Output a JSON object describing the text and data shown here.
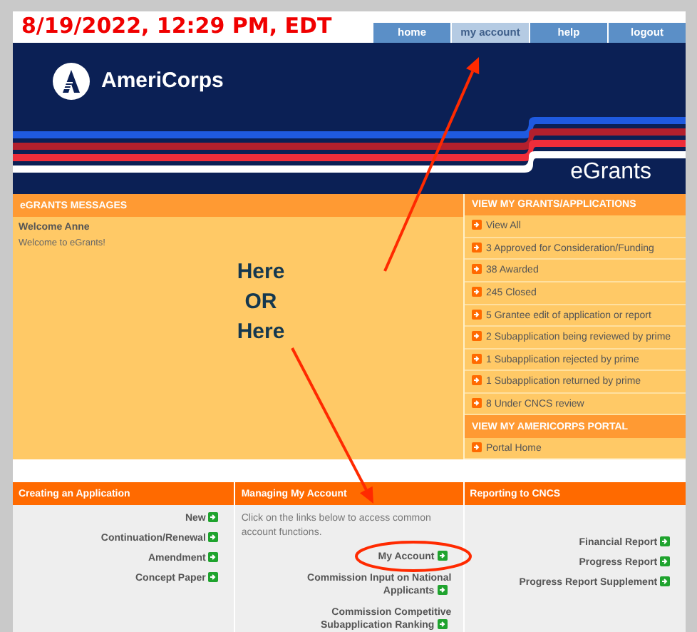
{
  "timestamp": "8/19/2022, 12:29 PM, EDT",
  "nav": [
    {
      "label": "home",
      "selected": false
    },
    {
      "label": "my account",
      "selected": true
    },
    {
      "label": "help",
      "selected": false
    },
    {
      "label": "logout",
      "selected": false
    }
  ],
  "banner": {
    "brand": "AmeriCorps",
    "product": "eGrants"
  },
  "messages": {
    "title": "eGRANTS MESSAGES",
    "greeting": "Welcome Anne",
    "text": "Welcome to eGrants!",
    "callout": [
      "Here",
      "OR",
      "Here"
    ]
  },
  "side_sections": [
    {
      "title": "VIEW MY GRANTS/APPLICATIONS",
      "items": [
        "View All",
        "3 Approved for Consideration/Funding",
        "38 Awarded",
        "245 Closed",
        "5 Grantee edit of application or report",
        "2 Subapplication being reviewed by prime",
        "1 Subapplication rejected by prime",
        "1 Subapplication returned by prime",
        "8 Under CNCS review"
      ]
    },
    {
      "title": "VIEW MY AMERICORPS PORTAL",
      "items": [
        "Portal Home"
      ]
    }
  ],
  "columns": [
    {
      "title": "Creating an Application",
      "links": [
        "New",
        "Continuation/Renewal",
        "Amendment",
        "Concept Paper"
      ]
    },
    {
      "title": "Managing My Account",
      "intro": "Click on the links below to access common account functions.",
      "links": [
        "My Account",
        "Commission Input on National Applicants",
        "Commission Competitive Subapplication Ranking"
      ]
    },
    {
      "title": "Reporting to CNCS",
      "links": [
        "Financial Report",
        "Progress Report",
        "Progress Report Supplement"
      ]
    }
  ],
  "annotations": [
    {
      "kind": "arrow",
      "color": "#ff2a00"
    },
    {
      "kind": "arrow",
      "color": "#ff2a00"
    },
    {
      "kind": "ellipse",
      "color": "#ff2a00"
    }
  ]
}
